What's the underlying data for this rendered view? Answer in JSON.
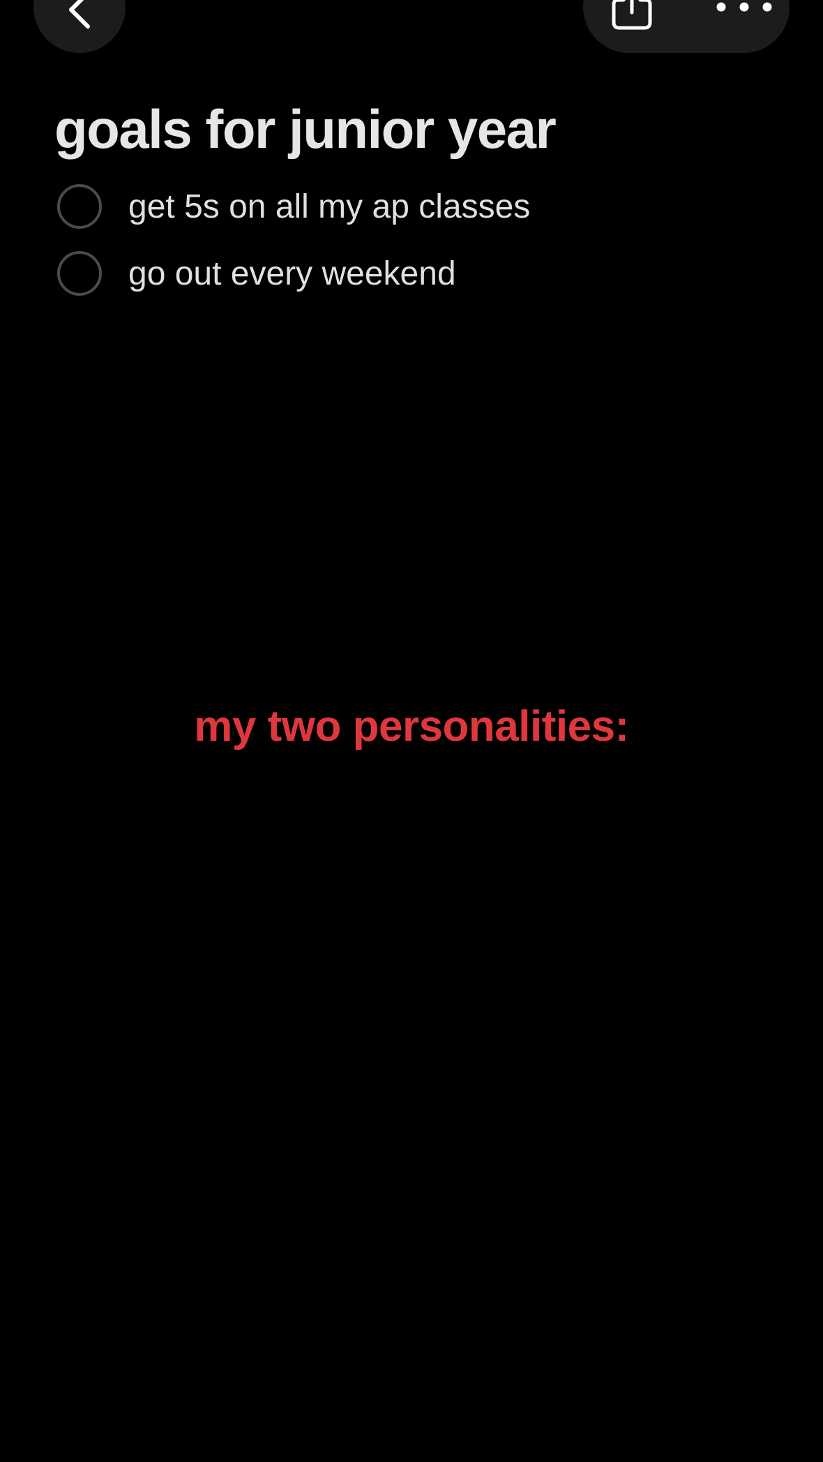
{
  "toolbar": {
    "back_icon": "chevron-left-icon",
    "share_icon": "share-icon",
    "more_icon": "ellipsis-icon"
  },
  "note": {
    "title": "goals for junior year",
    "checklist": [
      {
        "label": "get 5s on all my ap classes",
        "checked": false
      },
      {
        "label": "go out every weekend",
        "checked": false
      }
    ],
    "highlight_text": "my two personalities:"
  },
  "colors": {
    "background": "#000000",
    "button_background": "#1c1c1e",
    "title_text": "#e6e6e6",
    "body_text": "#e0e0e0",
    "highlight_red": "#e0373f",
    "checkbox_border": "#4a4a4c"
  }
}
